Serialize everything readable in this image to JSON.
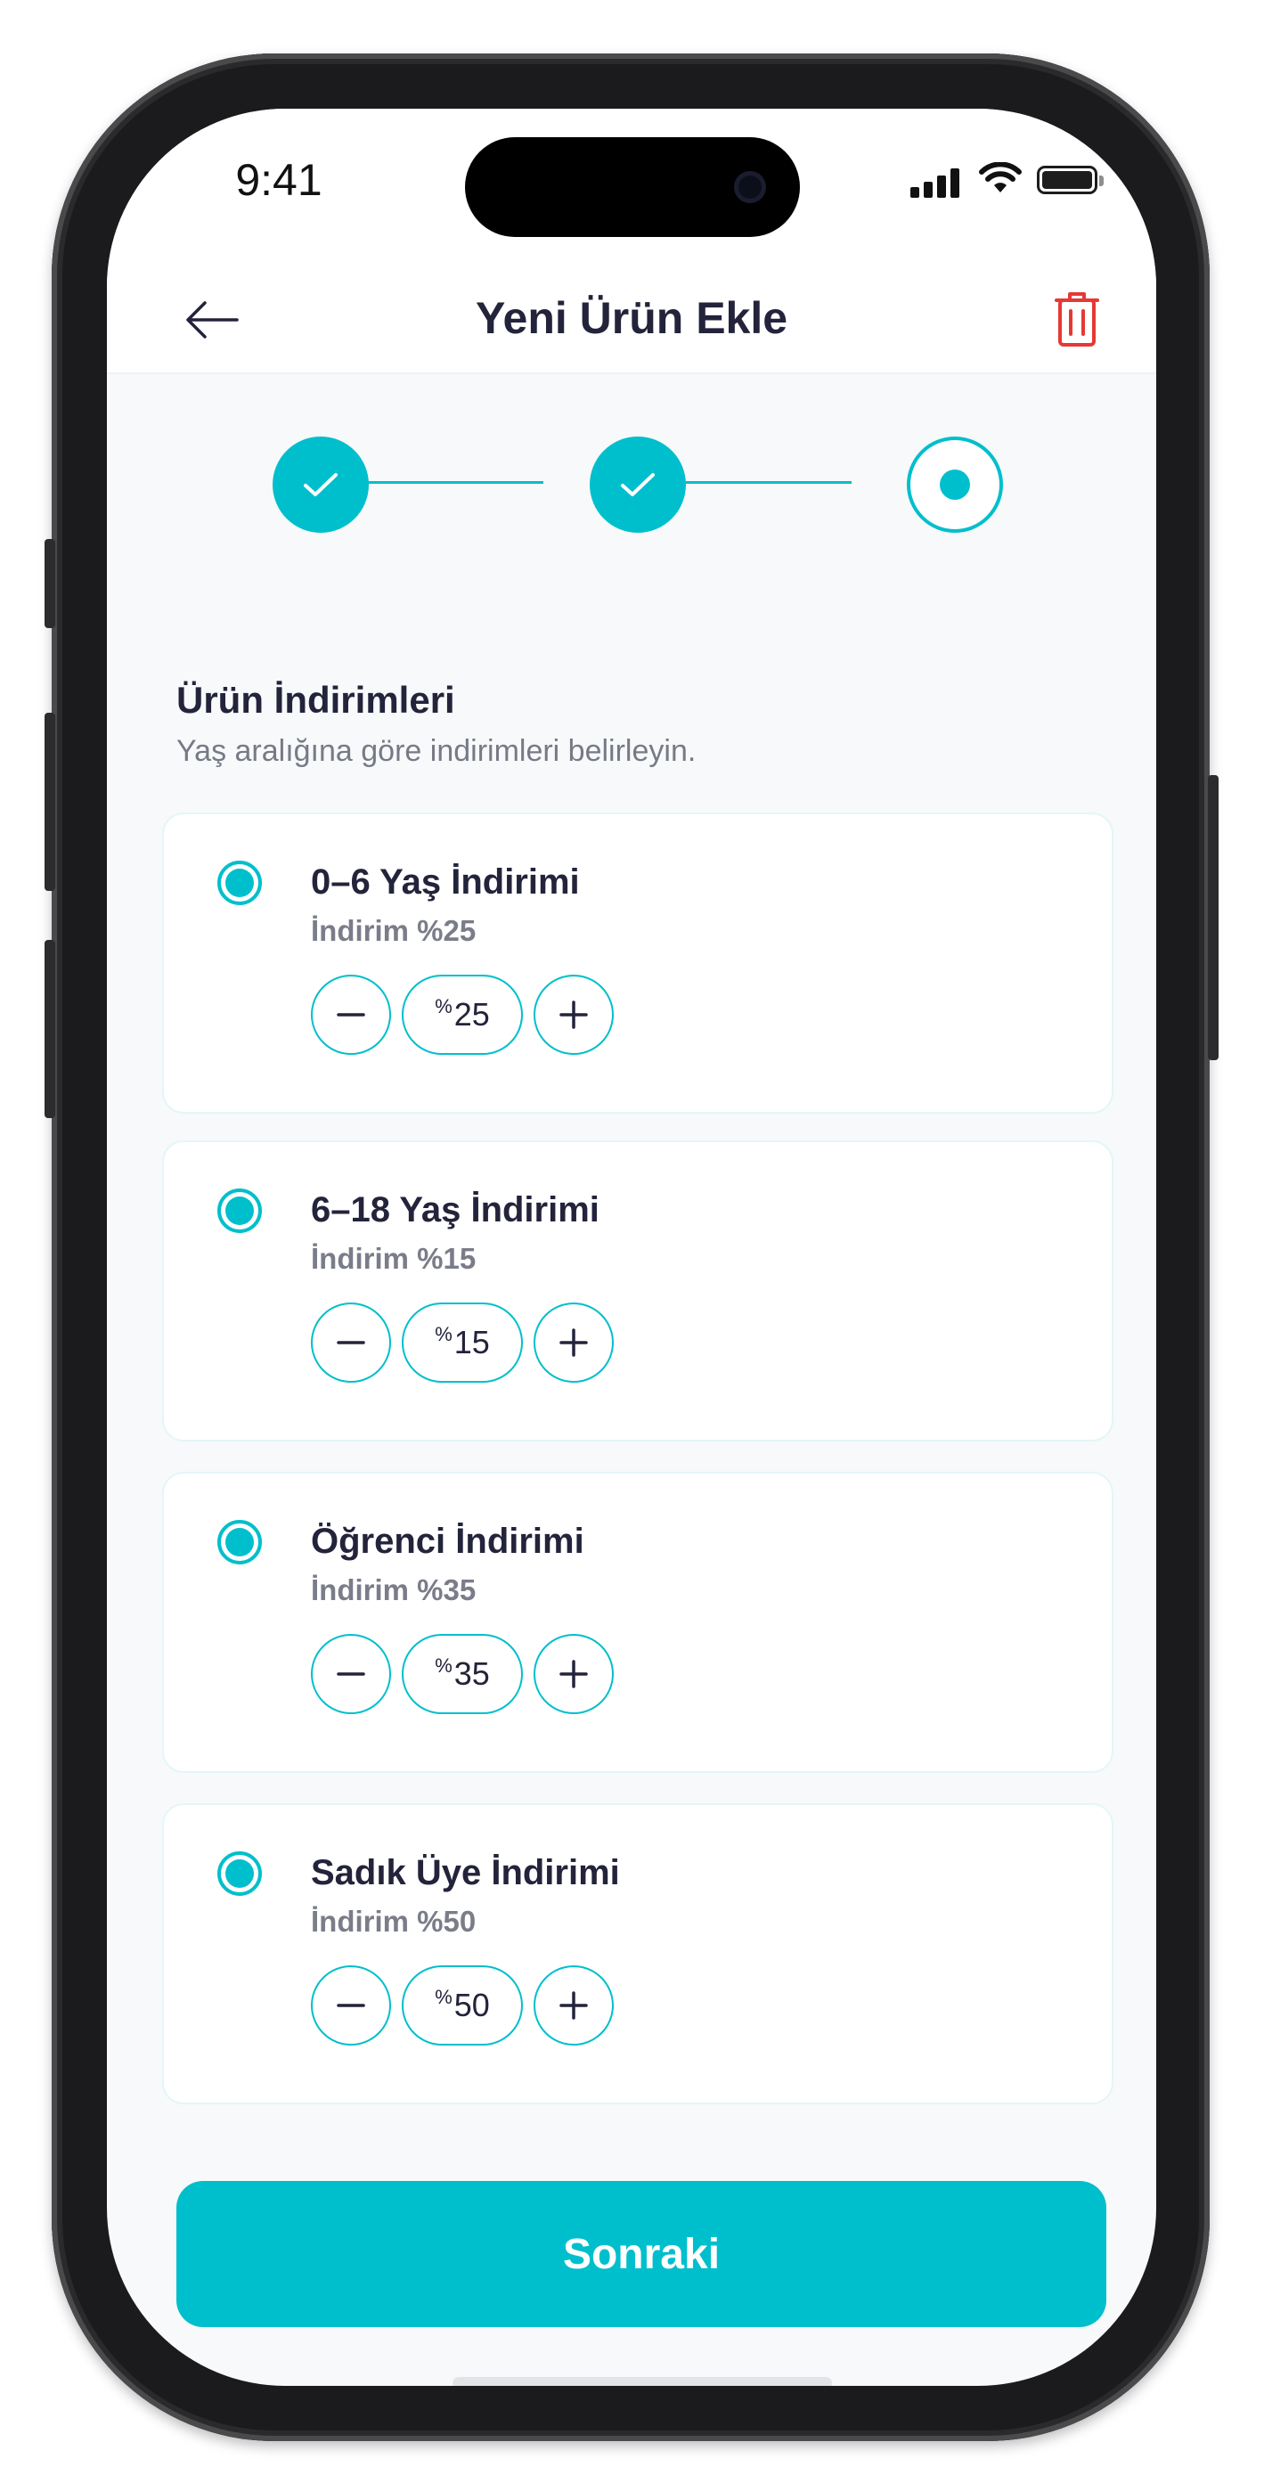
{
  "status_bar": {
    "time": "9:41"
  },
  "header": {
    "title": "Yeni Ürün Ekle",
    "back_icon": "arrow-left-icon",
    "trash_icon": "trash-icon"
  },
  "stepper": {
    "steps": [
      {
        "state": "completed"
      },
      {
        "state": "completed"
      },
      {
        "state": "current"
      }
    ]
  },
  "section": {
    "title": "Ürün İndirimleri",
    "subtitle": "Yaş aralığına göre indirimleri belirleyin."
  },
  "discounts": [
    {
      "title": "0–6 Yaş İndirimi",
      "subtitle": "İndirim %25",
      "percent_sign": "%",
      "value": "25",
      "selected": true
    },
    {
      "title": "6–18 Yaş İndirimi",
      "subtitle": "İndirim %15",
      "percent_sign": "%",
      "value": "15",
      "selected": true
    },
    {
      "title": "Öğrenci İndirimi",
      "subtitle": "İndirim %35",
      "percent_sign": "%",
      "value": "35",
      "selected": true
    },
    {
      "title": "Sadık Üye İndirimi",
      "subtitle": "İndirim %50",
      "percent_sign": "%",
      "value": "50",
      "selected": true
    }
  ],
  "actions": {
    "next_label": "Sonraki"
  },
  "colors": {
    "accent": "#00bfcc",
    "danger": "#e53935",
    "text_primary": "#23233b",
    "text_secondary": "#777a86"
  }
}
